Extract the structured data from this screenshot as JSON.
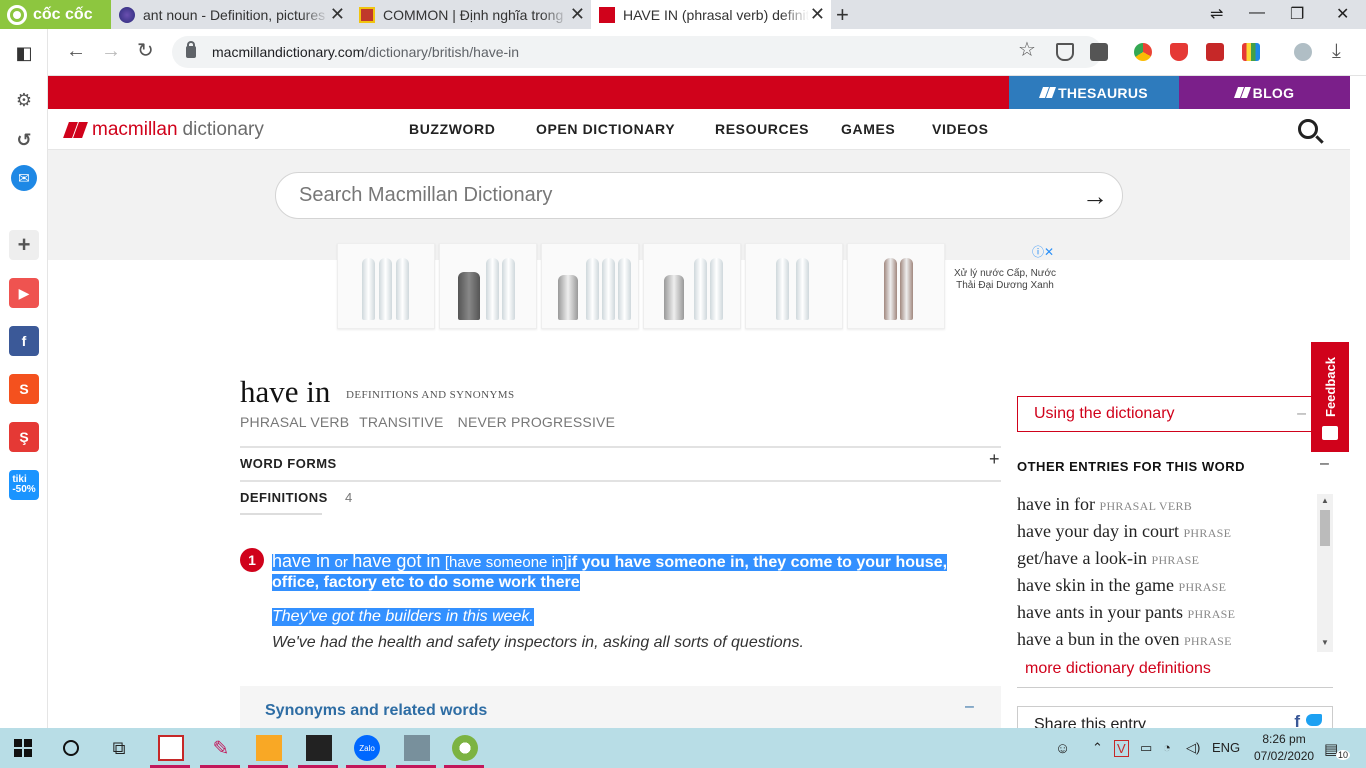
{
  "browser": {
    "brand": "cốc cốc",
    "tabs": [
      {
        "title": "ant noun - Definition, pictures"
      },
      {
        "title": "COMMON | Định nghĩa trong"
      },
      {
        "title": "HAVE IN (phrasal verb) definition"
      }
    ],
    "url_domain": "macmillandictionary.com",
    "url_path": "/dictionary/british/have-in"
  },
  "site": {
    "thesaurus": "THESAURUS",
    "blog": "BLOG",
    "logo_a": "macmillan",
    "logo_b": "dictionary",
    "nav": [
      "BUZZWORD",
      "OPEN DICTIONARY",
      "RESOURCES",
      "GAMES",
      "VIDEOS"
    ],
    "search_placeholder": "Search Macmillan Dictionary"
  },
  "ad": {
    "text": "Xử lý nước Cấp, Nước Thải Đại Dương Xanh"
  },
  "entry": {
    "headword": "have in",
    "sub": "DEFINITIONS AND SYNONYMS",
    "pos": [
      "PHRASAL VERB",
      "TRANSITIVE",
      "NEVER PROGRESSIVE"
    ],
    "word_forms": "WORD FORMS",
    "definitions": "DEFINITIONS",
    "def_count": "4",
    "sense_number": "1",
    "hw1": "have in",
    "or": "or",
    "hw2": "have got in",
    "pattern": "[have someone in]",
    "definition": "if you have someone in, they come to your house, office, factory etc to do some work there",
    "example1": "They've got the builders in this week.",
    "example2": "We've had the health and safety inspectors in, asking all sorts of questions.",
    "synonyms": "Synonyms and related words"
  },
  "sidebar_right": {
    "using": "Using the dictionary",
    "feedback": "Feedback",
    "other_entries_title": "OTHER ENTRIES FOR THIS WORD",
    "other_entries": [
      {
        "word": "have in for",
        "type": "PHRASAL VERB"
      },
      {
        "word": "have your day in court",
        "type": "PHRASE"
      },
      {
        "word": "get/have a look-in",
        "type": "PHRASE"
      },
      {
        "word": "have skin in the game",
        "type": "PHRASE"
      },
      {
        "word": "have ants in your pants",
        "type": "PHRASE"
      },
      {
        "word": "have a bun in the oven",
        "type": "PHRASE"
      }
    ],
    "more": "more dictionary definitions",
    "share": "Share this entry"
  },
  "taskbar": {
    "lang": "ENG",
    "time": "8:26 pm",
    "date": "07/02/2020",
    "notify": "10"
  }
}
